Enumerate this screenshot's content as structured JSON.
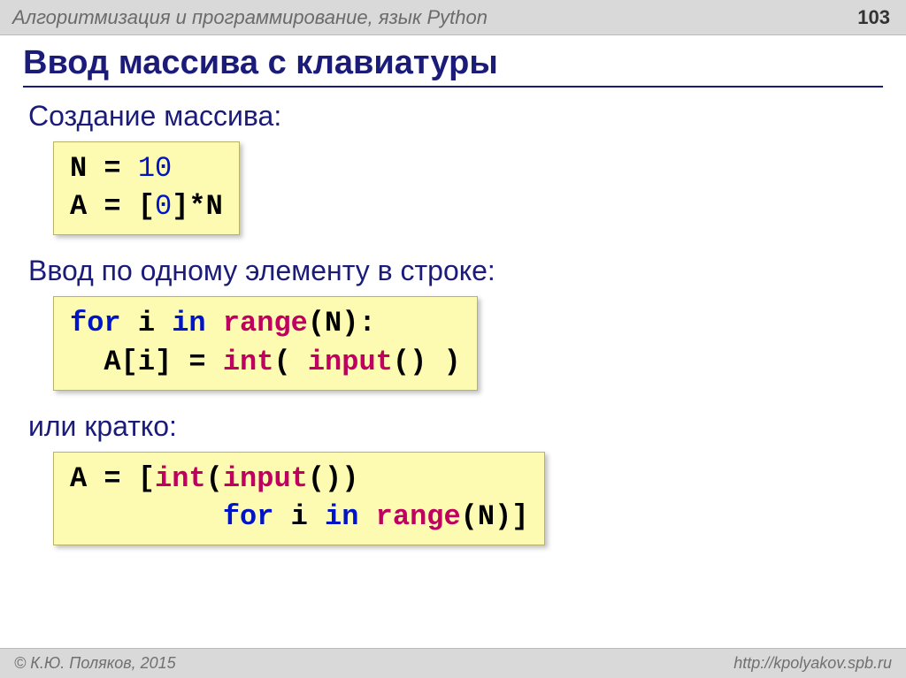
{
  "header": {
    "title": "Алгоритмизация и программирование, язык Python",
    "page": "103"
  },
  "slide_title": "Ввод массива с клавиатуры",
  "sections": {
    "s1_label": "Создание массива:",
    "s2_label": "Ввод по одному элементу в строке:",
    "s3_label": "или кратко:"
  },
  "code1": {
    "l1a": "N",
    "l1b": " = ",
    "l1c": "10",
    "l2a": "A",
    "l2b": " = [",
    "l2c": "0",
    "l2d": "]*N"
  },
  "code2": {
    "l1a": "for",
    "l1b": " i ",
    "l1c": "in",
    "l1d": " ",
    "l1e": "range",
    "l1f": "(N):",
    "l2a": "  A[i]",
    "l2b": " = ",
    "l2c": "int",
    "l2d": "( ",
    "l2e": "input",
    "l2f": "() )"
  },
  "code3": {
    "l1a": "A",
    "l1b": " = [",
    "l1c": "int",
    "l1d": "(",
    "l1e": "input",
    "l1f": "())",
    "l2a": "         ",
    "l2b": "for",
    "l2c": " i ",
    "l2d": "in",
    "l2e": " ",
    "l2f": "range",
    "l2g": "(N)]"
  },
  "footer": {
    "copyright": "© К.Ю. Поляков, 2015",
    "url": "http://kpolyakov.spb.ru"
  }
}
